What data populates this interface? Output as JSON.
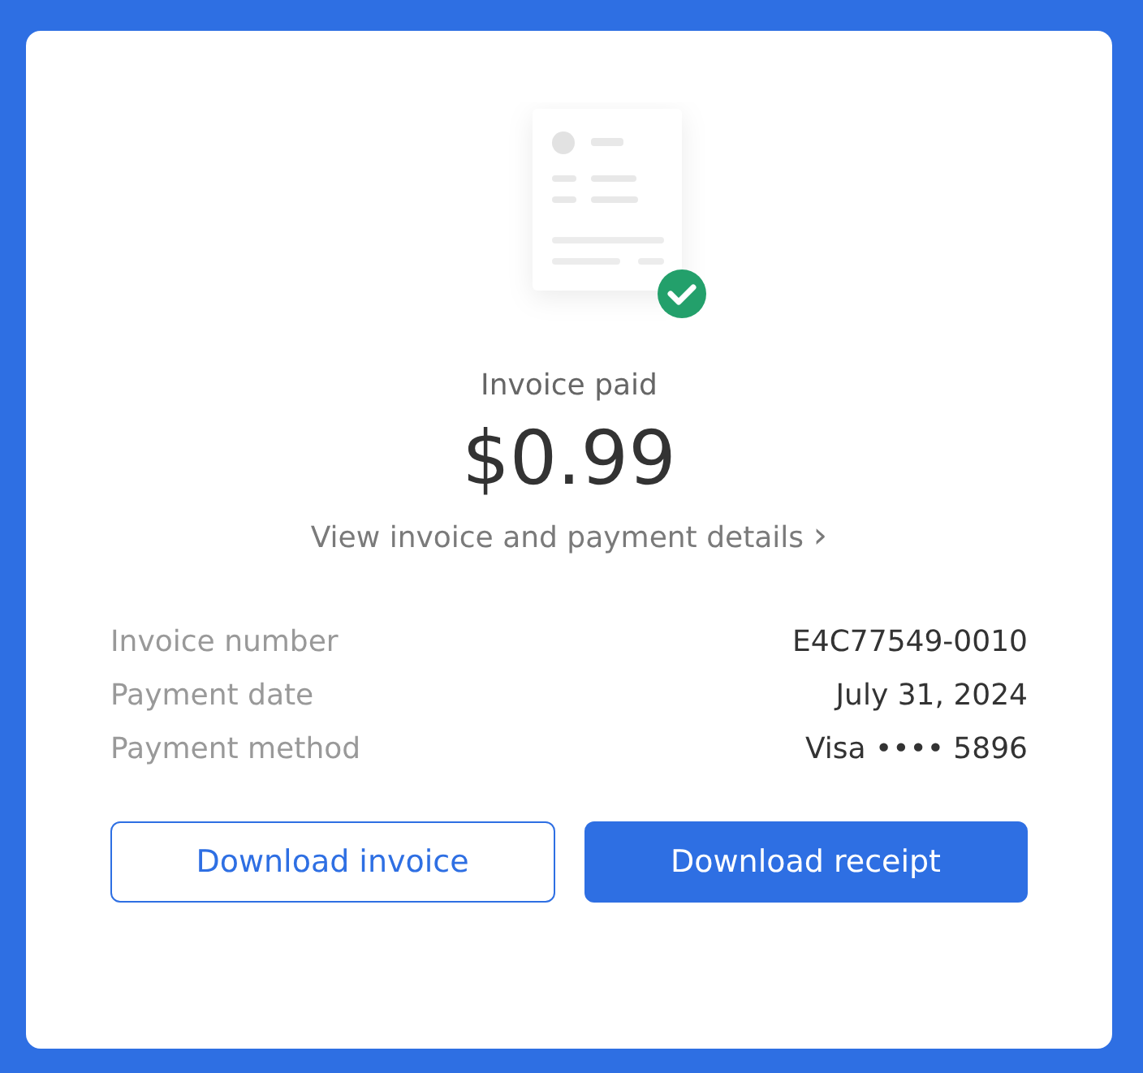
{
  "status": "Invoice paid",
  "amount": "$0.99",
  "details_link": {
    "label": "View invoice and payment details",
    "chevron": "›"
  },
  "details": [
    {
      "label": "Invoice number",
      "value": "E4C77549-0010"
    },
    {
      "label": "Payment date",
      "value": "July 31, 2024"
    },
    {
      "label": "Payment method",
      "value": "Visa •••• 5896"
    }
  ],
  "buttons": [
    {
      "label": "Download invoice",
      "kind": "outline"
    },
    {
      "label": "Download receipt",
      "kind": "primary"
    }
  ]
}
